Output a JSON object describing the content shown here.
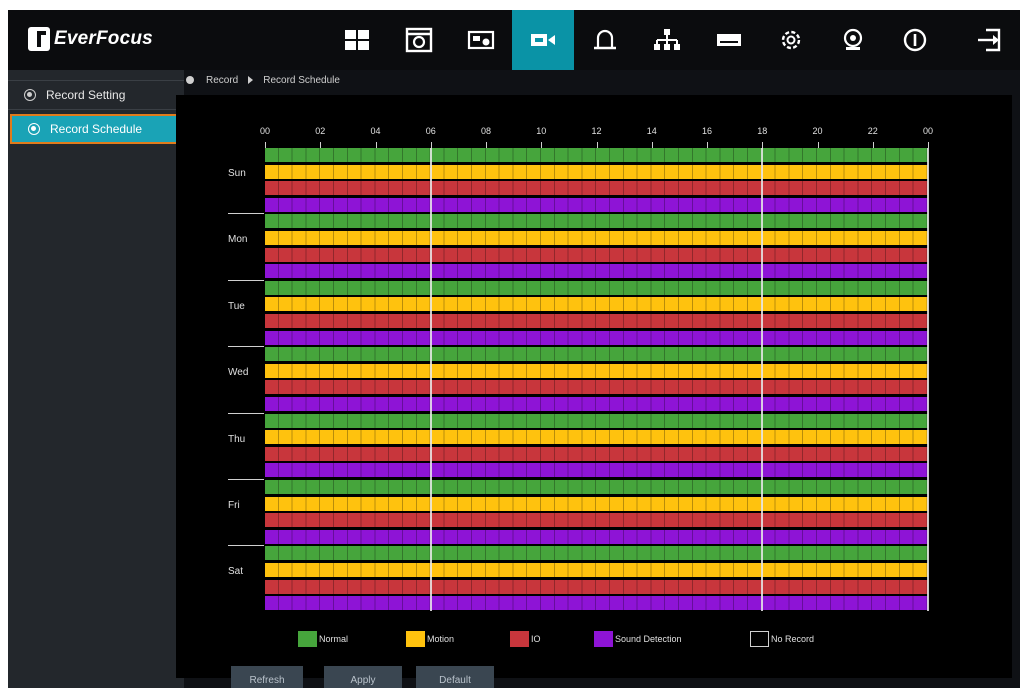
{
  "app": {
    "brand": "EverFocus"
  },
  "nav": {
    "items": [
      {
        "icon": "live-view-icon",
        "active": false
      },
      {
        "icon": "playback-icon",
        "active": false
      },
      {
        "icon": "camera-settings-icon",
        "active": false
      },
      {
        "icon": "record-icon",
        "active": true
      },
      {
        "icon": "alarm-icon",
        "active": false
      },
      {
        "icon": "network-icon",
        "active": false
      },
      {
        "icon": "storage-icon",
        "active": false
      },
      {
        "icon": "system-settings-icon",
        "active": false
      },
      {
        "icon": "maintenance-icon",
        "active": false
      },
      {
        "icon": "info-icon",
        "active": false
      },
      {
        "icon": "logout-icon",
        "active": false
      }
    ],
    "active_color": "#0a93a6"
  },
  "sidebar": {
    "items": [
      {
        "label": "Record Setting",
        "selected": false
      },
      {
        "label": "Record Schedule",
        "selected": true
      }
    ]
  },
  "breadcrumb": {
    "parent": "Record",
    "current": "Record Schedule"
  },
  "schedule": {
    "hours": [
      "00",
      "02",
      "04",
      "06",
      "08",
      "10",
      "12",
      "14",
      "16",
      "18",
      "20",
      "22",
      "00"
    ],
    "days": [
      "Sun",
      "Mon",
      "Tue",
      "Wed",
      "Thu",
      "Fri",
      "Sat"
    ],
    "row_types": [
      "normal",
      "motion",
      "io",
      "sound"
    ],
    "colors": {
      "normal": "#46a53c",
      "motion": "#ffc20e",
      "io": "#c8363c",
      "sound": "#8e14d6",
      "none": "#000000"
    }
  },
  "legend": [
    {
      "type": "normal",
      "label": "Normal",
      "color": "#46a53c"
    },
    {
      "type": "motion",
      "label": "Motion",
      "color": "#ffc20e"
    },
    {
      "type": "io",
      "label": "IO",
      "color": "#c8363c"
    },
    {
      "type": "sound",
      "label": "Sound Detection",
      "color": "#8e14d6"
    },
    {
      "type": "none",
      "label": "No Record",
      "color": "#000000"
    }
  ],
  "actions": {
    "refresh": "Refresh",
    "apply": "Apply",
    "default": "Default"
  }
}
